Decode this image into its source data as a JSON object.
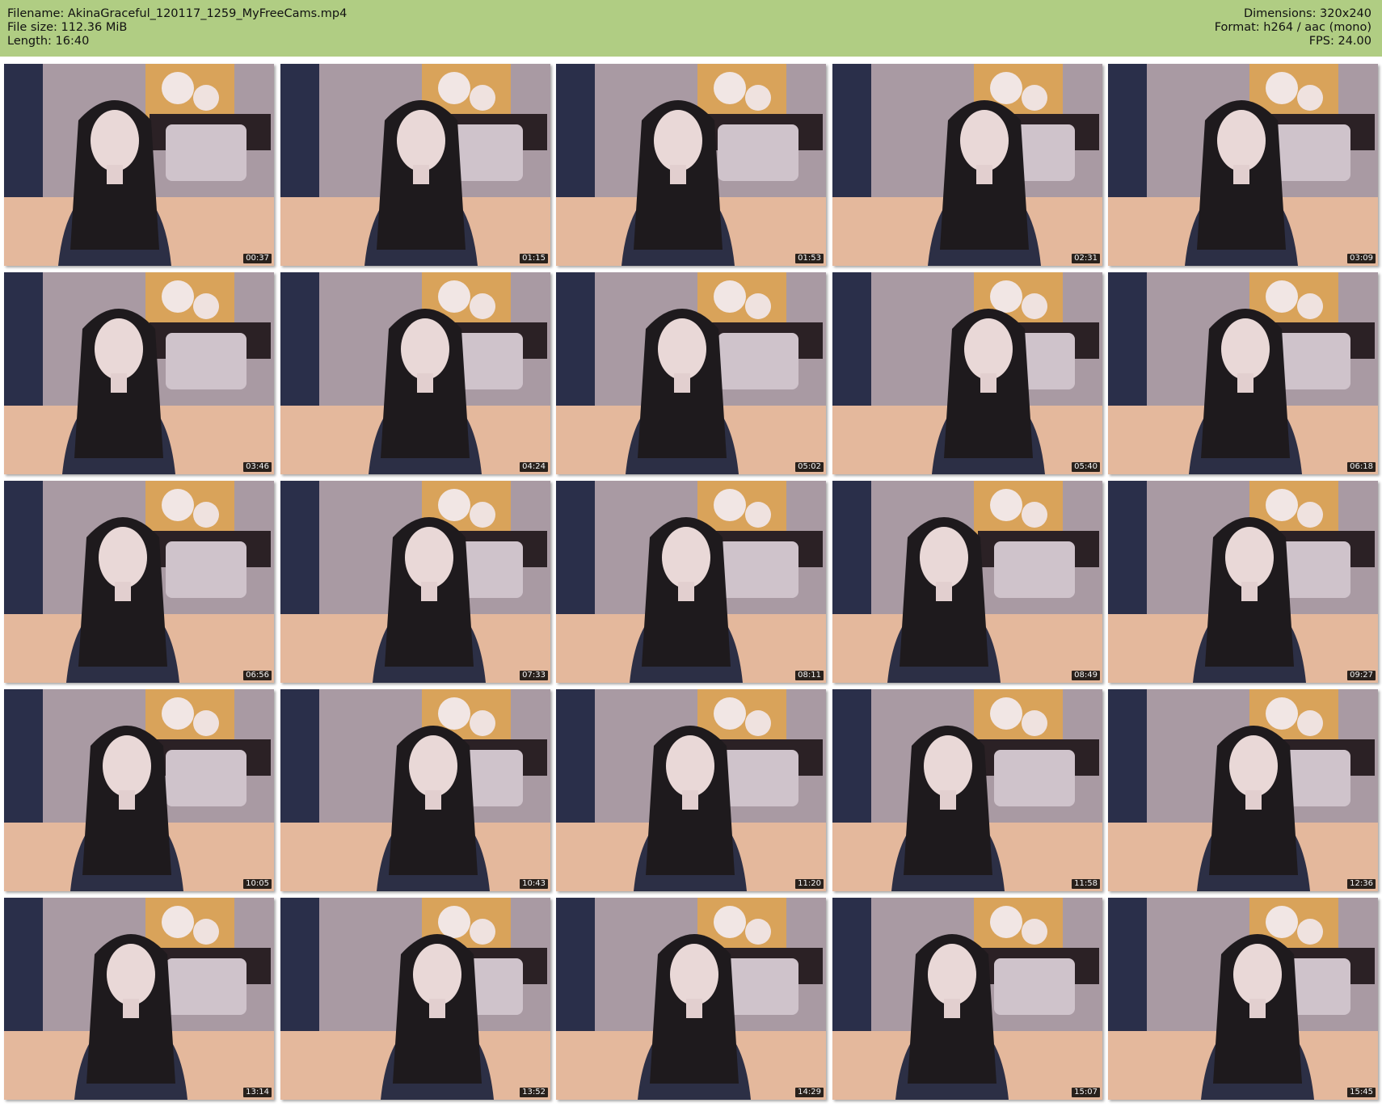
{
  "info": {
    "filename_line": "Filename: AkinaGraceful_120117_1259_MyFreeCams.mp4",
    "filesize_line": "File size: 112.36 MiB",
    "length_line": "Length: 16:40",
    "dimensions_line": "Dimensions: 320x240",
    "format_line": "Format: h264 / aac (mono)",
    "fps_line": "FPS: 24.00"
  },
  "colors": {
    "header_bg": "#b0cd83",
    "background": "#ffffff"
  },
  "thumbnails": [
    {
      "timestamp": "00:37"
    },
    {
      "timestamp": "01:15"
    },
    {
      "timestamp": "01:53"
    },
    {
      "timestamp": "02:31"
    },
    {
      "timestamp": "03:09"
    },
    {
      "timestamp": "03:46"
    },
    {
      "timestamp": "04:24"
    },
    {
      "timestamp": "05:02"
    },
    {
      "timestamp": "05:40"
    },
    {
      "timestamp": "06:18"
    },
    {
      "timestamp": "06:56"
    },
    {
      "timestamp": "07:33"
    },
    {
      "timestamp": "08:11"
    },
    {
      "timestamp": "08:49"
    },
    {
      "timestamp": "09:27"
    },
    {
      "timestamp": "10:05"
    },
    {
      "timestamp": "10:43"
    },
    {
      "timestamp": "11:20"
    },
    {
      "timestamp": "11:58"
    },
    {
      "timestamp": "12:36"
    },
    {
      "timestamp": "13:14"
    },
    {
      "timestamp": "13:52"
    },
    {
      "timestamp": "14:29"
    },
    {
      "timestamp": "15:07"
    },
    {
      "timestamp": "15:45"
    }
  ]
}
